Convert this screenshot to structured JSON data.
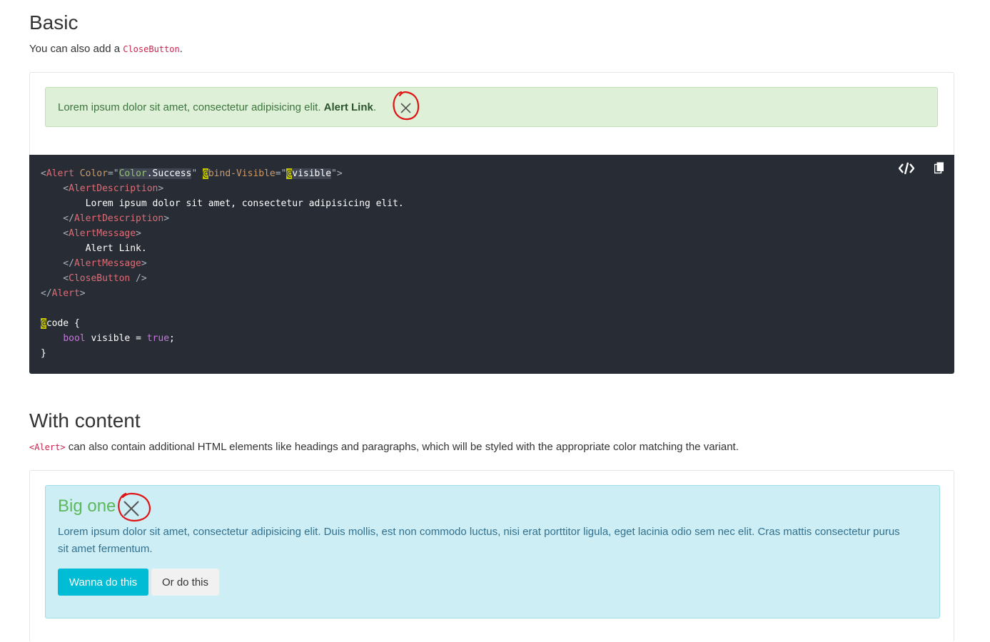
{
  "basic": {
    "title": "Basic",
    "desc_prefix": "You can also add a ",
    "desc_code": "CloseButton",
    "desc_suffix": ".",
    "alert_text": "Lorem ipsum dolor sit amet, consectetur adipisicing elit. ",
    "alert_link": "Alert Link",
    "alert_after_link": "."
  },
  "code_lines": [
    [
      {
        "t": "<",
        "c": "tk-punc"
      },
      {
        "t": "Alert",
        "c": "tk-tag"
      },
      {
        "t": " Color",
        "c": "tk-attr"
      },
      {
        "t": "=\"",
        "c": "tk-punc"
      },
      {
        "t": "Color",
        "c": "tk-str hl"
      },
      {
        "t": ".Success",
        "c": "hl"
      },
      {
        "t": "\" ",
        "c": "tk-punc"
      },
      {
        "t": "@",
        "c": "at"
      },
      {
        "t": "bind-Visible",
        "c": "tk-attr"
      },
      {
        "t": "=\"",
        "c": "tk-punc"
      },
      {
        "t": "@",
        "c": "at"
      },
      {
        "t": "visible",
        "c": "hl"
      },
      {
        "t": "\">",
        "c": "tk-punc"
      }
    ],
    [
      {
        "t": "    <",
        "c": "tk-punc"
      },
      {
        "t": "AlertDescription",
        "c": "tk-tag"
      },
      {
        "t": ">",
        "c": "tk-punc"
      }
    ],
    [
      {
        "t": "        Lorem ipsum dolor sit amet, consectetur adipisicing elit.",
        "c": ""
      }
    ],
    [
      {
        "t": "    </",
        "c": "tk-punc"
      },
      {
        "t": "AlertDescription",
        "c": "tk-tag"
      },
      {
        "t": ">",
        "c": "tk-punc"
      }
    ],
    [
      {
        "t": "    <",
        "c": "tk-punc"
      },
      {
        "t": "AlertMessage",
        "c": "tk-tag"
      },
      {
        "t": ">",
        "c": "tk-punc"
      }
    ],
    [
      {
        "t": "        Alert Link.",
        "c": ""
      }
    ],
    [
      {
        "t": "    </",
        "c": "tk-punc"
      },
      {
        "t": "AlertMessage",
        "c": "tk-tag"
      },
      {
        "t": ">",
        "c": "tk-punc"
      }
    ],
    [
      {
        "t": "    <",
        "c": "tk-punc"
      },
      {
        "t": "CloseButton",
        "c": "tk-tag"
      },
      {
        "t": " />",
        "c": "tk-punc"
      }
    ],
    [
      {
        "t": "</",
        "c": "tk-punc"
      },
      {
        "t": "Alert",
        "c": "tk-tag"
      },
      {
        "t": ">",
        "c": "tk-punc"
      }
    ],
    [],
    [
      {
        "t": "@",
        "c": "at"
      },
      {
        "t": "code {",
        "c": ""
      }
    ],
    [
      {
        "t": "    ",
        "c": ""
      },
      {
        "t": "bool",
        "c": "tk-kw"
      },
      {
        "t": " visible = ",
        "c": ""
      },
      {
        "t": "true",
        "c": "tk-kw"
      },
      {
        "t": ";",
        "c": ""
      }
    ],
    [
      {
        "t": "}",
        "c": ""
      }
    ]
  ],
  "content": {
    "title": "With content",
    "desc_code": "<Alert>",
    "desc_text": " can also contain additional HTML elements like headings and paragraphs, which will be styled with the appropriate color matching the variant.",
    "heading": "Big one",
    "paragraph": "Lorem ipsum dolor sit amet, consectetur adipisicing elit. Duis mollis, est non commodo luctus, nisi erat porttitor ligula, eget lacinia odio sem nec elit. Cras mattis consectetur purus sit amet fermentum.",
    "primary_button": "Wanna do this",
    "secondary_button": "Or do this"
  },
  "icons": {
    "close": "close-icon",
    "code_toggle": "code-icon",
    "copy": "copy-icon",
    "annotation": "red-circle-annotation"
  },
  "colors": {
    "success_bg": "#dff0d8",
    "info_bg": "#cdeef4",
    "info_button": "#00bcd4",
    "code_bg": "#282c34",
    "annotation": "#e01414"
  }
}
